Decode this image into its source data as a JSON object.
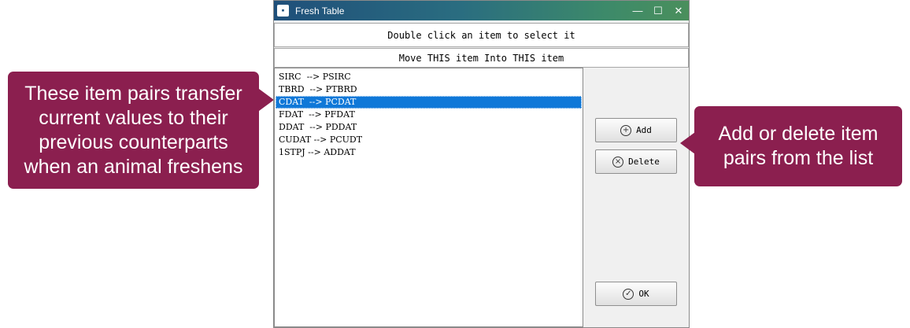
{
  "window": {
    "title": "Fresh Table",
    "app_icon": "fresh-table-app-icon",
    "controls": {
      "minimize": "—",
      "maximize": "☐",
      "close": "✕"
    }
  },
  "instruction": "Double click an item to select it",
  "list_heading": "Move THIS item Into THIS item",
  "items": [
    "SIRC  --> PSIRC",
    "TBRD  --> PTBRD",
    "CDAT  --> PCDAT",
    "FDAT  --> PFDAT",
    "DDAT  --> PDDAT",
    "CUDAT --> PCUDT",
    "1STPJ --> ADDAT"
  ],
  "selected_index": 2,
  "buttons": {
    "add": {
      "label": "Add",
      "icon": "plus-circle-icon"
    },
    "delete": {
      "label": "Delete",
      "icon": "x-circle-icon"
    },
    "ok": {
      "label": "OK",
      "icon": "check-circle-icon"
    }
  },
  "callouts": {
    "left": "These item pairs transfer current values to their previous counterparts when an animal freshens",
    "right": "Add or delete item pairs from the list"
  },
  "colors": {
    "callout": "#8b1f4f",
    "selection": "#0f78d8"
  }
}
